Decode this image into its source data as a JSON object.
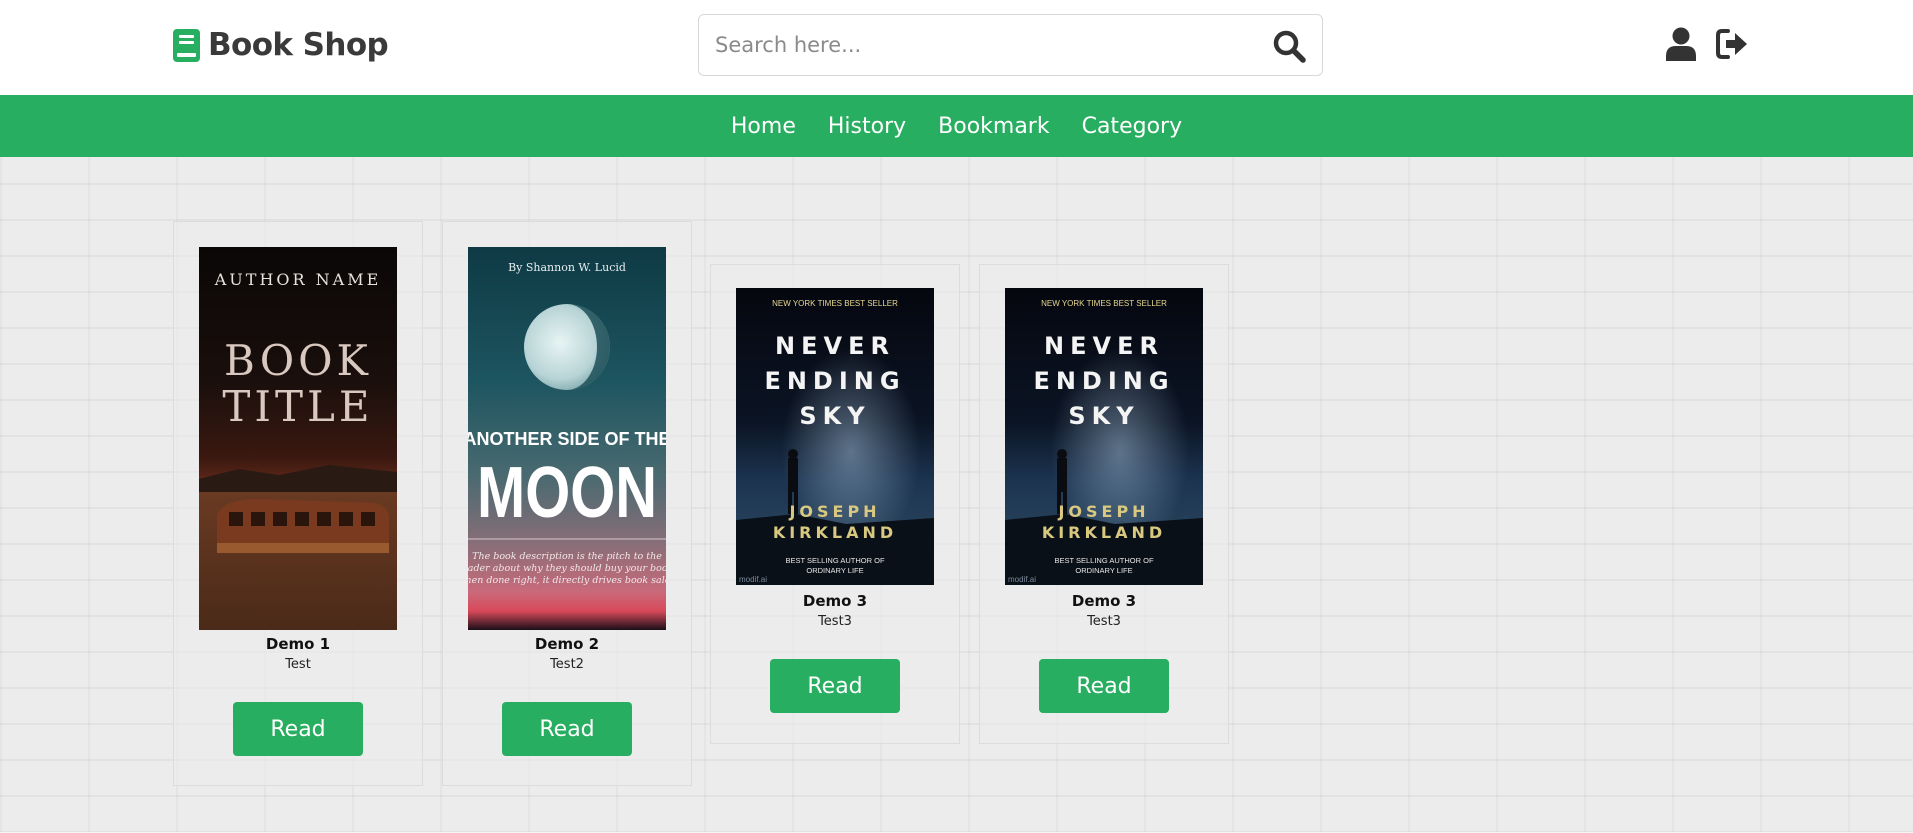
{
  "header": {
    "brand": "Book Shop",
    "search_placeholder": "Search here..."
  },
  "nav": {
    "items": [
      "Home",
      "History",
      "Bookmark",
      "Category"
    ]
  },
  "books": [
    {
      "title": "Demo 1",
      "author": "Test",
      "button": "Read",
      "cover": {
        "author_name": "AUTHOR NAME",
        "line1": "BOOK",
        "line2": "TITLE"
      }
    },
    {
      "title": "Demo 2",
      "author": "Test2",
      "button": "Read",
      "cover": {
        "byline": "By Shannon W. Lucid",
        "line1": "ANOTHER SIDE OF THE",
        "line2": "MOON",
        "desc1": "The book description is the pitch to the",
        "desc2": "reader about why they should buy your book.",
        "desc3": "When done right, it directly drives book sales."
      }
    },
    {
      "title": "Demo 3",
      "author": "Test3",
      "button": "Read",
      "cover": {
        "top": "NEW YORK TIMES BEST SELLER",
        "line1": "NEVER",
        "line2": "ENDING",
        "line3": "SKY",
        "author1": "JOSEPH",
        "author2": "KIRKLAND",
        "sub1": "BEST SELLING AUTHOR OF",
        "sub2": "ORDINARY LIFE",
        "watermark": "modif.ai"
      }
    },
    {
      "title": "Demo 3",
      "author": "Test3",
      "button": "Read",
      "cover": {
        "top": "NEW YORK TIMES BEST SELLER",
        "line1": "NEVER",
        "line2": "ENDING",
        "line3": "SKY",
        "author1": "JOSEPH",
        "author2": "KIRKLAND",
        "sub1": "BEST SELLING AUTHOR OF",
        "sub2": "ORDINARY LIFE",
        "watermark": "modif.ai"
      }
    }
  ],
  "colors": {
    "primary": "#27ae60",
    "text_dark": "#3a3a3a",
    "background": "#ececec"
  }
}
